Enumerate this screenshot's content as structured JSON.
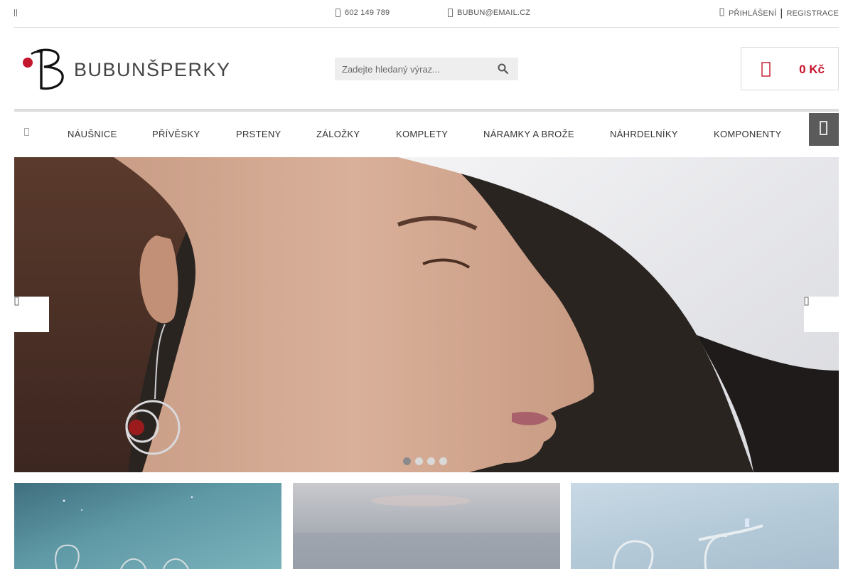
{
  "topbar": {
    "phone": "602 149 789",
    "email": "BUBUN@EMAIL.CZ",
    "login": "PŘIHLÁŠENÍ",
    "separator": "|",
    "register": "REGISTRACE"
  },
  "header": {
    "logo_text": "BUBUNŠPERKY",
    "search_placeholder": "Zadejte hledaný výraz...",
    "cart_total": "0 Kč"
  },
  "nav": {
    "items": [
      {
        "label": "NÁUŠNICE"
      },
      {
        "label": "PŘÍVĚSKY"
      },
      {
        "label": "PRSTENY"
      },
      {
        "label": "ZÁLOŽKY"
      },
      {
        "label": "KOMPLETY"
      },
      {
        "label": "NÁRAMKY A BROŽE"
      },
      {
        "label": "NÁHRDELNÍKY"
      },
      {
        "label": "KOMPONENTY"
      }
    ]
  },
  "hero": {
    "slide_count": 4,
    "active_slide": 1
  },
  "colors": {
    "accent_red": "#c4162c",
    "nav_button": "#5b5b5b",
    "search_bg": "#eeeeee"
  },
  "icons": {
    "menu": "menu-icon",
    "phone": "phone-icon",
    "email": "mail-icon",
    "login": "user-icon",
    "search": "search-icon",
    "cart": "shopping-bag-icon",
    "home": "home-icon",
    "nav_menu": "hamburger-icon",
    "prev": "chevron-left-icon",
    "next": "chevron-right-icon"
  }
}
